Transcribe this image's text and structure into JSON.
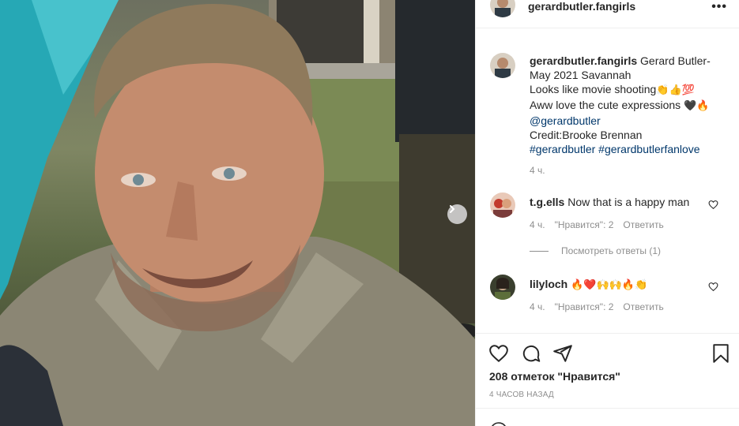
{
  "header": {
    "username": "gerardbutler.fangirls",
    "more_label": "•••"
  },
  "caption": {
    "username": "gerardbutler.fangirls",
    "line1": "Gerard Butler- May 2021 Savannah",
    "line2": "Looks like movie shooting",
    "line2_emoji": "👏👍💯",
    "line3": "Aww love the cute expressions",
    "line3_emoji": "🖤🔥",
    "mention": "@gerardbutler",
    "credit": "Credit:Brooke Brennan",
    "hashtags": "#gerardbutler #gerardbutlerfanlove",
    "time": "4 ч."
  },
  "comments": [
    {
      "username": "t.g.ells",
      "text": "Now that is a happy man",
      "time": "4 ч.",
      "likes": "\"Нравится\": 2",
      "reply": "Ответить",
      "view_replies": "Посмотреть ответы (1)"
    },
    {
      "username": "lilyloch",
      "text": "🔥❤️🙌🙌🔥👏",
      "time": "4 ч.",
      "likes": "\"Нравится\": 2",
      "reply": "Ответить"
    }
  ],
  "footer": {
    "likes": "208 отметок \"Нравится\"",
    "posted": "4 ЧАСОВ НАЗАД"
  },
  "icons": {
    "like": "heart-icon",
    "comment": "comment-icon",
    "share": "share-icon",
    "save": "bookmark-icon",
    "next": "chevron-right-icon",
    "more": "more-dots-icon",
    "emoji": "smile-icon"
  },
  "colors": {
    "link": "#00376b",
    "muted": "#8e8e8e",
    "border": "#efefef"
  }
}
